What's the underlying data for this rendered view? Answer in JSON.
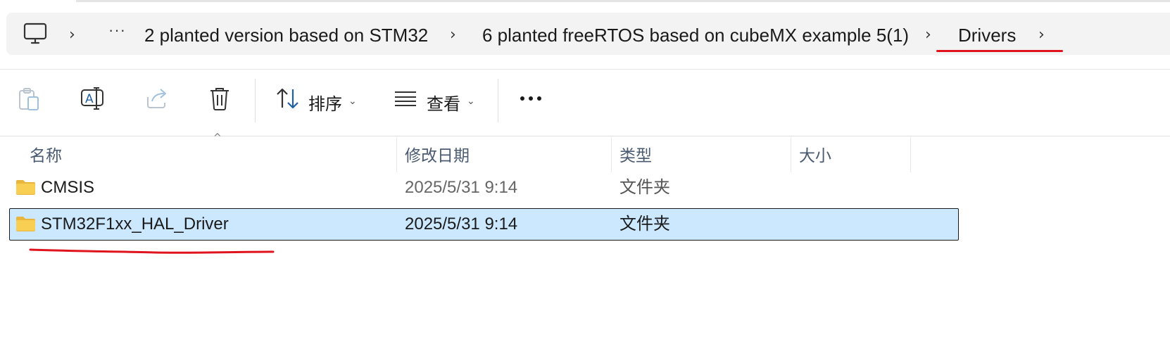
{
  "address_bar": {
    "crumbs": [
      "2 planted version based on STM32",
      "6 planted freeRTOS based on cubeMX example 5(1)",
      "Drivers"
    ],
    "more": "···",
    "chevron": "›"
  },
  "toolbar": {
    "sort_label": "排序",
    "view_label": "查看",
    "more": "···",
    "caret": "⌄"
  },
  "columns": {
    "name": "名称",
    "date": "修改日期",
    "type": "类型",
    "size": "大小"
  },
  "files": [
    {
      "name": "CMSIS",
      "date": "2025/5/31 9:14",
      "type": "文件夹",
      "size": "",
      "selected": false
    },
    {
      "name": "STM32F1xx_HAL_Driver",
      "date": "2025/5/31 9:14",
      "type": "文件夹",
      "size": "",
      "selected": true
    }
  ],
  "colors": {
    "annotation_red": "#e0141e",
    "selection": "#cce8ff",
    "folder": "#f6c744"
  },
  "icons": [
    "computer-icon",
    "copy-icon",
    "rename-icon",
    "share-icon",
    "delete-icon",
    "sort-icon",
    "view-icon",
    "more-icon",
    "folder-icon"
  ]
}
